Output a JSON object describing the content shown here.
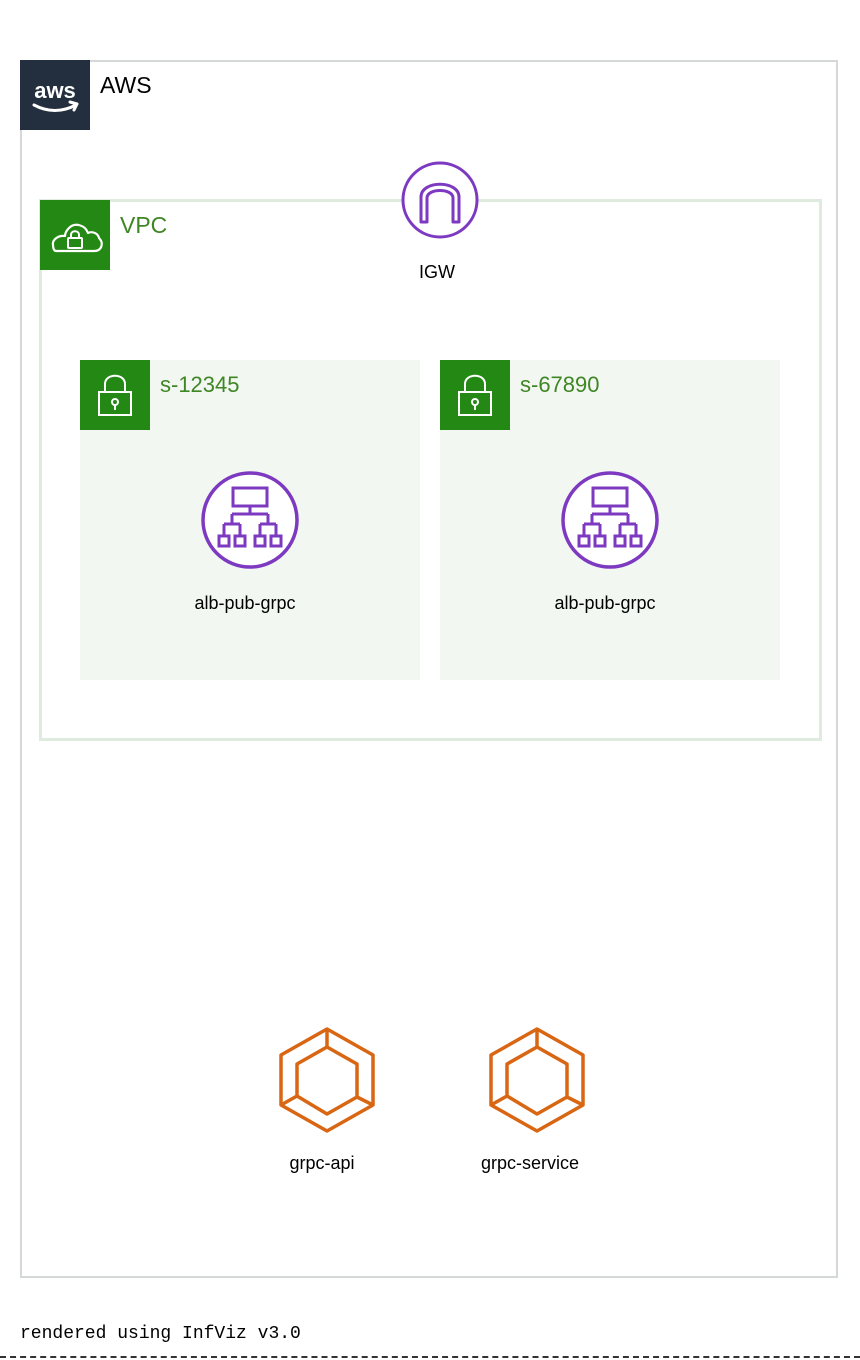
{
  "groups": {
    "aws": {
      "label": "AWS",
      "icon": "aws-logo-icon",
      "border_color": "#d5d8d9",
      "tile_color": "#232f3e"
    },
    "vpc": {
      "label": "VPC",
      "icon": "vpc-cloud-lock-icon",
      "border_color": "#dfebdf",
      "tile_color": "#248814",
      "label_color": "#3f8624"
    },
    "subnets": [
      {
        "label": "s-12345",
        "icon": "subnet-lock-icon",
        "fill_color": "#f2f7f2",
        "tile_color": "#248814"
      },
      {
        "label": "s-67890",
        "icon": "subnet-lock-icon",
        "fill_color": "#f2f7f2",
        "tile_color": "#248814"
      }
    ]
  },
  "nodes": {
    "igw": {
      "label": "IGW",
      "icon": "internet-gateway-icon",
      "color": "#7d3ac1"
    },
    "alb": [
      {
        "label": "alb-pub-grpc",
        "icon": "load-balancer-icon",
        "color": "#7d3ac1"
      },
      {
        "label": "alb-pub-grpc",
        "icon": "load-balancer-icon",
        "color": "#7d3ac1"
      }
    ],
    "services": [
      {
        "label": "grpc-api",
        "icon": "ecs-service-icon",
        "color": "#d86613"
      },
      {
        "label": "grpc-service",
        "icon": "ecs-service-icon",
        "color": "#d86613"
      }
    ]
  },
  "footer": {
    "text": "rendered using InfViz v3.0"
  }
}
